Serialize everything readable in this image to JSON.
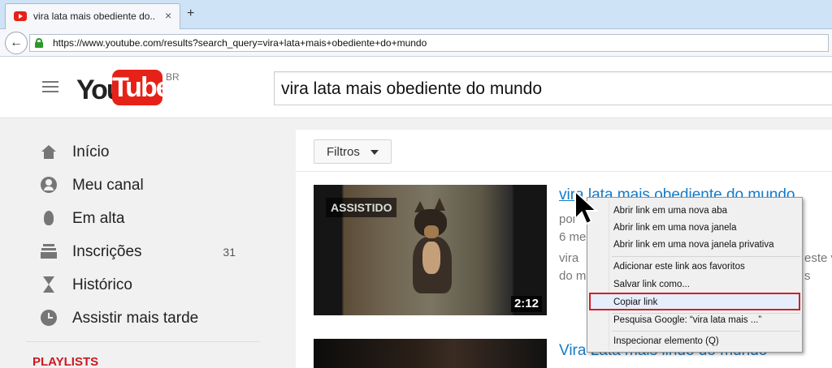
{
  "browser": {
    "tab_title": "vira lata mais obediente do...",
    "tab_close": "×",
    "new_tab": "+",
    "back": "←",
    "url": "https://www.youtube.com/results?search_query=vira+lata+mais+obediente+do+mundo"
  },
  "header": {
    "logo_you": "You",
    "logo_tube": "Tube",
    "logo_region": "BR",
    "search_query": "vira lata mais obediente do mundo"
  },
  "sidebar": {
    "items": [
      {
        "label": "Início",
        "icon": "home-icon"
      },
      {
        "label": "Meu canal",
        "icon": "account-icon"
      },
      {
        "label": "Em alta",
        "icon": "flame-icon"
      },
      {
        "label": "Inscrições",
        "icon": "subscriptions-icon",
        "count": "31"
      },
      {
        "label": "Histórico",
        "icon": "hourglass-icon"
      },
      {
        "label": "Assistir mais tarde",
        "icon": "clock-icon"
      }
    ],
    "playlists_heading": "PLAYLISTS"
  },
  "results": {
    "filters_label": "Filtros",
    "videos": [
      {
        "title": "vira lata mais obediente do mundo",
        "watched_badge": "ASSISTIDO",
        "duration": "2:12",
        "meta_by": "por",
        "meta_age": "6 me",
        "desc_1a": "vira",
        "desc_1b": "este v",
        "desc_2a": "do m",
        "desc_2b": "s"
      },
      {
        "title": "Vira Lata mais lindo do mundo"
      }
    ]
  },
  "context_menu": {
    "items": [
      "Abrir link em uma nova aba",
      "Abrir link em uma nova janela",
      "Abrir link em uma nova janela privativa",
      "Adicionar este link aos favoritos",
      "Salvar link como...",
      "Copiar link",
      "Pesquisa Google: “vira lata mais ...”",
      "Inspecionar elemento (Q)"
    ]
  },
  "colors": {
    "youtube_red": "#e62117",
    "link_blue": "#167ac6",
    "highlight_border": "#d21f26"
  }
}
